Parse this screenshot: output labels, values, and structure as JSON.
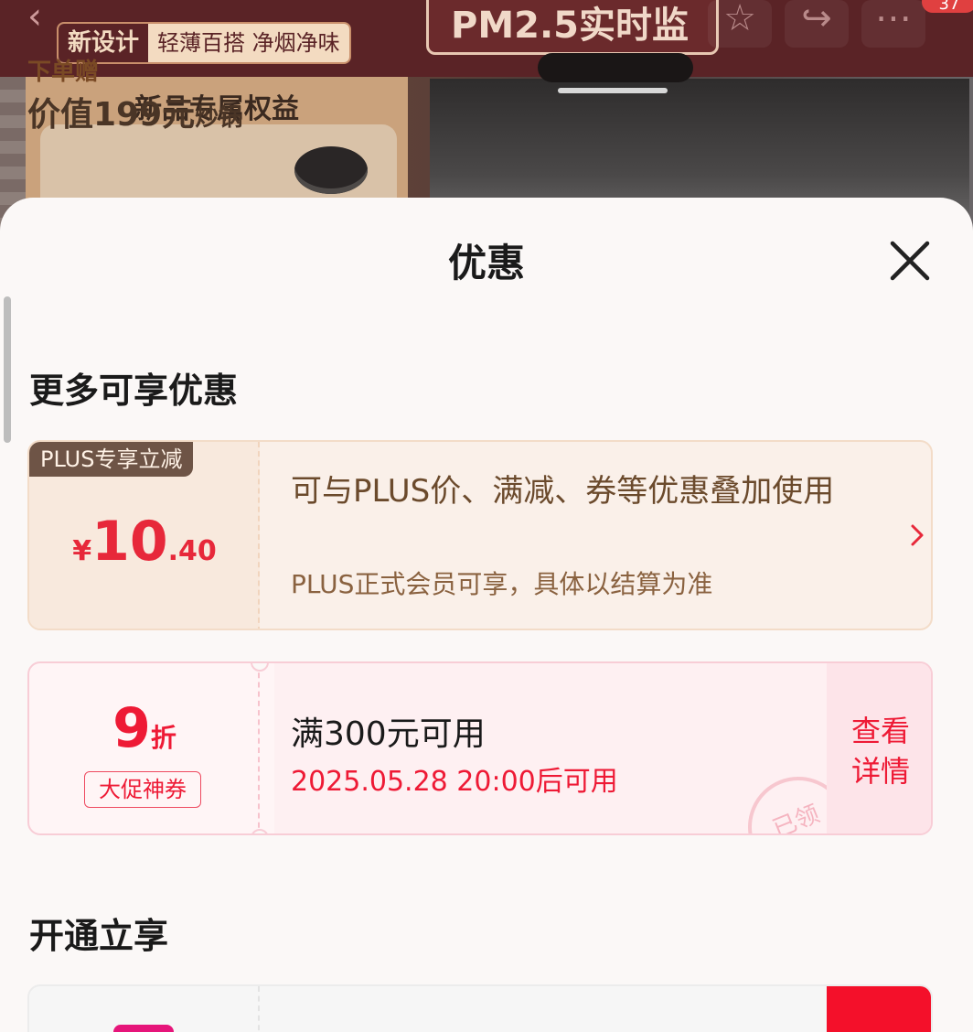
{
  "background": {
    "tag_main": "新设计",
    "tag_sub": "轻薄百搭 净烟净味",
    "headline": "PM2.5实时监",
    "card_title": "新品专属权益",
    "card_line1": "下单赠",
    "card_line2_main": "价值199元",
    "card_line2_suffix": "炒锅",
    "cart_badge": "37"
  },
  "sheet": {
    "title": "优惠"
  },
  "section_more": {
    "title": "更多可享优惠"
  },
  "plus_offer": {
    "tag": "PLUS专享立减",
    "currency": "¥",
    "amount_int": "10",
    "amount_dec": ".40",
    "description": "可与PLUS价、满减、券等优惠叠加使用",
    "note": "PLUS正式会员可享，具体以结算为准"
  },
  "coupon": {
    "value": "9",
    "unit": "折",
    "type": "大促神券",
    "condition": "满300元可用",
    "valid_time": "2025.05.28 20:00后可用",
    "stamp": "已领",
    "detail_line1": "查看",
    "detail_line2": "详情"
  },
  "section_open": {
    "title": "开通立享"
  }
}
